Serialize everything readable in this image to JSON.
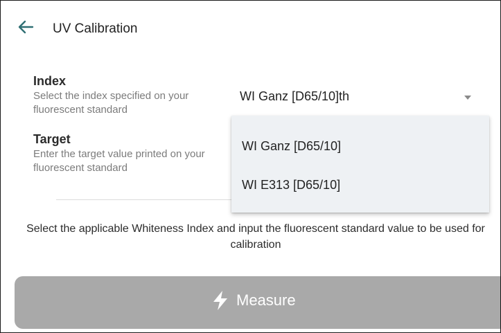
{
  "header": {
    "title": "UV Calibration",
    "back_icon": "arrow-left-icon",
    "back_icon_color": "#2f6f73"
  },
  "index": {
    "label": "Index",
    "description": "Select the index specified on your fluorescent standard",
    "selected_value": "WI Ganz [D65/10]th",
    "options": [
      "WI Ganz [D65/10]",
      "WI E313 [D65/10]"
    ]
  },
  "target": {
    "label": "Target",
    "description": "Enter the target value printed on your fluorescent standard"
  },
  "hint": "Select the applicable Whiteness Index and input the fluorescent standard value to be used for calibration",
  "measure": {
    "label": "Measure",
    "icon": "lightning-bolt-icon",
    "background_color": "#a9a9a9",
    "state": "disabled"
  }
}
